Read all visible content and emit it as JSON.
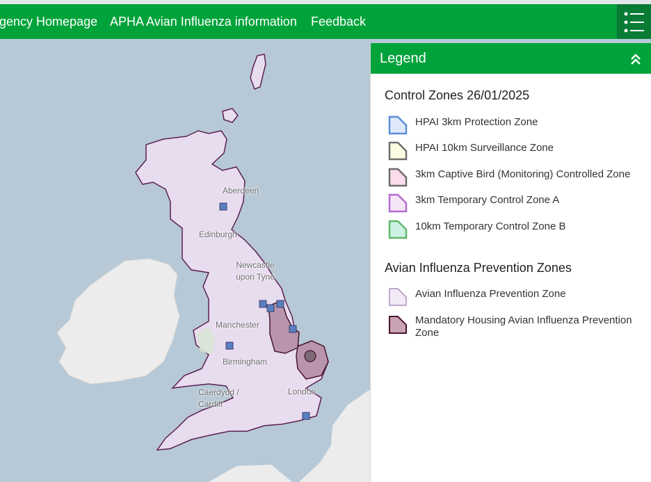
{
  "nav": {
    "links": [
      "gency Homepage",
      "APHA Avian Influenza information",
      "Feedback"
    ],
    "menu_icon": "list-menu-icon"
  },
  "map": {
    "cities": [
      "Aberdeen",
      "Edinburgh",
      "Newcastle upon Tyne",
      "Manchester",
      "Birmingham",
      "Caerdydd / Cardiff",
      "London"
    ]
  },
  "legend": {
    "title": "Legend",
    "collapse_icon": "double-chevron-up-icon",
    "sections": [
      {
        "title": "Control Zones 26/01/2025",
        "items": [
          {
            "label": "HPAI 3km Protection Zone",
            "stroke": "#5b8fd6",
            "fill": "#dde9fb"
          },
          {
            "label": "HPAI 10km Surveillance Zone",
            "stroke": "#6e6e6e",
            "fill": "#fbfbe2"
          },
          {
            "label": "3km Captive Bird (Monitoring) Controlled Zone",
            "stroke": "#6b6b6b",
            "fill": "#fbdcec"
          },
          {
            "label": "3km Temporary Control Zone A",
            "stroke": "#b36ad1",
            "fill": "#f4e6f7"
          },
          {
            "label": "10km Temporary Control Zone B",
            "stroke": "#5fb86a",
            "fill": "#ccf2e4"
          }
        ]
      },
      {
        "title": "Avian Influenza Prevention Zones",
        "items": [
          {
            "label": "Avian Influenza Prevention Zone",
            "stroke": "#a98fb8",
            "fill": "#f2e9f6"
          },
          {
            "label": "Mandatory Housing Avian Influenza Prevention Zone",
            "stroke": "#4a1530",
            "fill": "#c9a3b3"
          }
        ]
      }
    ]
  },
  "colors": {
    "brand_green": "#00a33a",
    "menu_dark_green": "#087c35",
    "sea": "#b7c9d6",
    "land": "#ececec",
    "aipz_fill": "#e8dcef",
    "aipz_border": "#5a1f52",
    "housing_fill": "#b895ad",
    "case_marker": "#5a7fc0"
  }
}
